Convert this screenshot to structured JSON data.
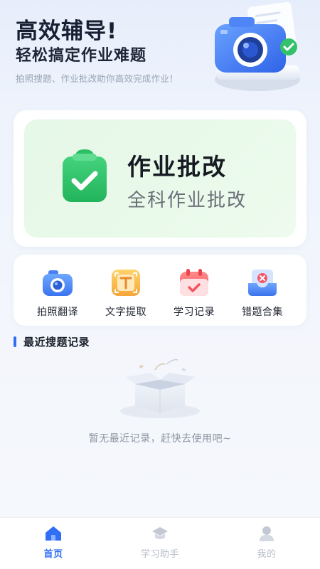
{
  "hero": {
    "title": "高效辅导!",
    "subtitle": "轻松搞定作业难题",
    "description": "拍照搜题、作业批改助你高效完成作业！",
    "illustration": "camera-illustration"
  },
  "feature": {
    "title": "作业批改",
    "subtitle": "全科作业批改",
    "icon": "clipboard-check-icon",
    "color": "#2fc36a"
  },
  "tools": [
    {
      "label": "拍照翻译",
      "icon": "camera-icon"
    },
    {
      "label": "文字提取",
      "icon": "text-scan-icon"
    },
    {
      "label": "学习记录",
      "icon": "calendar-check-icon"
    },
    {
      "label": "错题合集",
      "icon": "inbox-error-icon"
    }
  ],
  "recent": {
    "title": "最近搜题记录",
    "empty_text": "暂无最近记录，赶快去使用吧~",
    "empty_icon": "empty-box-icon"
  },
  "nav": [
    {
      "label": "首页",
      "icon": "home-icon",
      "active": true
    },
    {
      "label": "学习助手",
      "icon": "graduation-cap-icon",
      "active": false
    },
    {
      "label": "我的",
      "icon": "user-icon",
      "active": false
    }
  ],
  "colors": {
    "accent": "#2f6ef5",
    "feature_bg": "#e7f8e9",
    "inactive_nav": "#b6bcc8"
  }
}
